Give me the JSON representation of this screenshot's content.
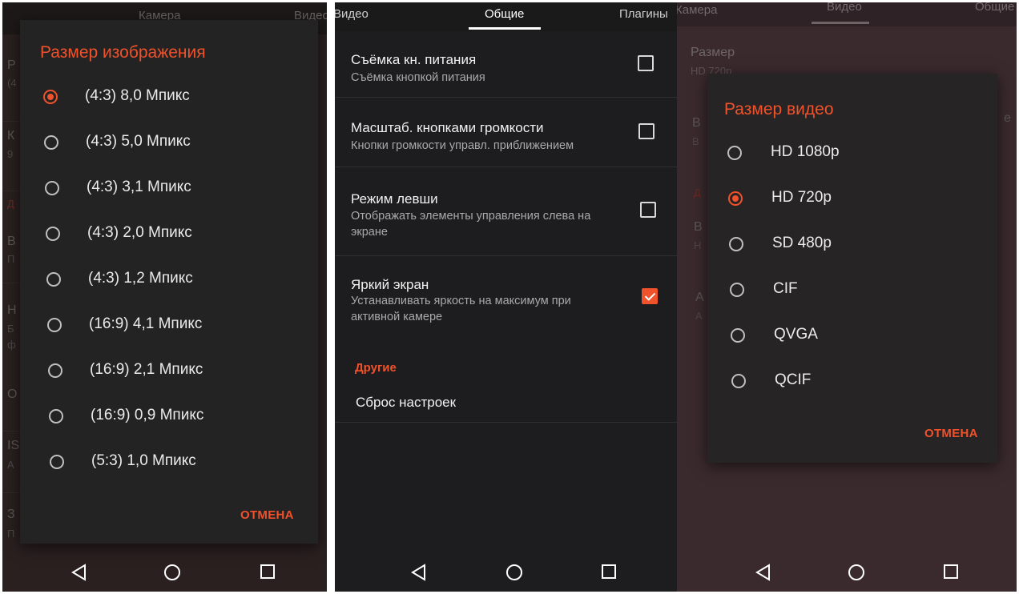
{
  "left_panel": {
    "bg_tabs": [
      "Камера",
      "Видео"
    ],
    "ghost_letters": [
      "Р",
      "(4",
      "К",
      "9",
      "Д",
      "В",
      "П",
      "Н",
      "Б",
      "ф",
      "О",
      "IS",
      "А",
      "З",
      "П"
    ],
    "dialog": {
      "title": "Размер изображения",
      "options": [
        {
          "label": "(4:3) 8,0 Мпикс",
          "selected": true
        },
        {
          "label": "(4:3) 5,0 Мпикс",
          "selected": false
        },
        {
          "label": "(4:3) 3,1 Мпикс",
          "selected": false
        },
        {
          "label": "(4:3) 2,0 Мпикс",
          "selected": false
        },
        {
          "label": "(4:3) 1,2 Мпикс",
          "selected": false
        },
        {
          "label": "(16:9) 4,1 Мпикс",
          "selected": false
        },
        {
          "label": "(16:9) 2,1 Мпикс",
          "selected": false
        },
        {
          "label": "(16:9) 0,9 Мпикс",
          "selected": false
        },
        {
          "label": "(5:3) 1,0 Мпикс",
          "selected": false
        }
      ],
      "cancel_label": "ОТМЕНА"
    }
  },
  "middle_panel": {
    "tabs": [
      {
        "label": "Видео",
        "active": false
      },
      {
        "label": "Общие",
        "active": true
      },
      {
        "label": "Плагины",
        "active": false
      }
    ],
    "settings": [
      {
        "title": "Съёмка кн. питания",
        "subtitle": "Съёмка кнопкой питания",
        "checked": false
      },
      {
        "title": "Масштаб. кнопками громкости",
        "subtitle": "Кнопки громкости управл. приближением",
        "checked": false
      },
      {
        "title": "Режим левши",
        "subtitle": "Отображать элементы управления слева на экране",
        "checked": false
      },
      {
        "title": "Яркий экран",
        "subtitle": "Устанавливать яркость на максимум при активной камере",
        "checked": true
      }
    ],
    "section_header": "Другие",
    "reset_label": "Сброс настроек"
  },
  "right_panel": {
    "bg_tabs": [
      "Камера",
      "Видео",
      "Общие"
    ],
    "ghost": {
      "size_title": "Размер",
      "size_value": "HD 720p",
      "letters": [
        "В",
        "В",
        "Д",
        "В",
        "Н",
        "А",
        "А",
        "е"
      ]
    },
    "dialog": {
      "title": "Размер видео",
      "options": [
        {
          "label": "HD 1080p",
          "selected": false
        },
        {
          "label": "HD 720p",
          "selected": true
        },
        {
          "label": "SD 480p",
          "selected": false
        },
        {
          "label": "CIF",
          "selected": false
        },
        {
          "label": "QVGA",
          "selected": false
        },
        {
          "label": "QCIF",
          "selected": false
        }
      ],
      "cancel_label": "ОТМЕНА"
    }
  },
  "nav_icons": [
    "back-icon",
    "home-icon",
    "recents-icon"
  ],
  "colors": {
    "accent": "#f0522b",
    "dialog_bg": "#232323",
    "list_bg": "#1d1d1f"
  }
}
